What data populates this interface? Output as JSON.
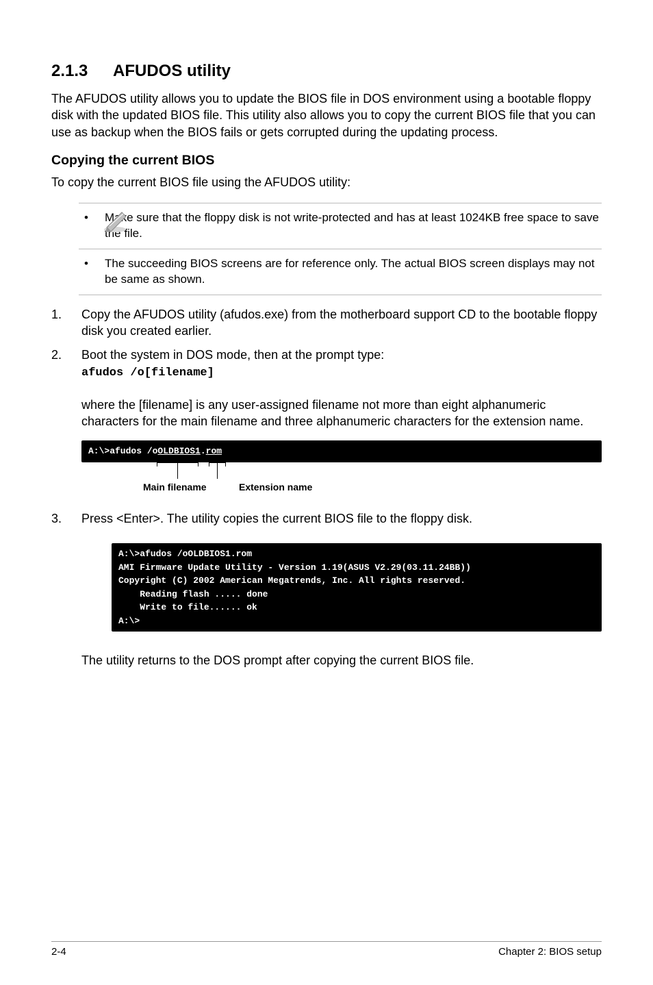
{
  "section": {
    "number": "2.1.3",
    "title": "AFUDOS utility",
    "intro": "The AFUDOS utility allows you to update the BIOS file in DOS environment using a bootable floppy disk with the updated BIOS file. This utility also allows you to copy the current BIOS file that you can use as backup when the BIOS fails or gets corrupted during the updating process."
  },
  "sub": {
    "title": "Copying the current BIOS",
    "intro": "To copy the current BIOS file using the AFUDOS utility:"
  },
  "notes": {
    "bullet": "•",
    "items": [
      "Make sure that the floppy disk is not write-protected and has at least 1024KB free space to save the file.",
      "The succeeding BIOS screens are for reference only. The actual BIOS screen displays may not be same as shown."
    ]
  },
  "steps": {
    "s1": {
      "num": "1.",
      "text": "Copy the AFUDOS utility (afudos.exe) from the motherboard support CD to the bootable floppy disk you created earlier."
    },
    "s2": {
      "num": "2.",
      "text": "Boot the system in DOS mode, then at the prompt type:",
      "code": "afudos /o[filename]"
    },
    "s2post": "where the [filename] is any user-assigned filename not more than eight alphanumeric characters  for the main filename and three alphanumeric characters for the extension name.",
    "s3": {
      "num": "3.",
      "text": "Press <Enter>. The utility copies the current BIOS file to the floppy disk."
    }
  },
  "term1": {
    "prefix": "A:\\>afudos /o",
    "main": "OLDBIOS1",
    "dot": ".",
    "ext": "rom"
  },
  "labels": {
    "main": "Main filename",
    "ext": "Extension name"
  },
  "term2": {
    "l1": "A:\\>afudos /oOLDBIOS1.rom",
    "l2": "AMI Firmware Update Utility - Version 1.19(ASUS V2.29(03.11.24BB))",
    "l3": "Copyright (C) 2002 American Megatrends, Inc. All rights reserved.",
    "l4": "    Reading flash ..... done",
    "l5": "    Write to file...... ok",
    "l6": "A:\\>"
  },
  "after": "The utility returns to the DOS prompt after copying the current BIOS file.",
  "footer": {
    "left": "2-4",
    "right": "Chapter 2: BIOS setup"
  }
}
